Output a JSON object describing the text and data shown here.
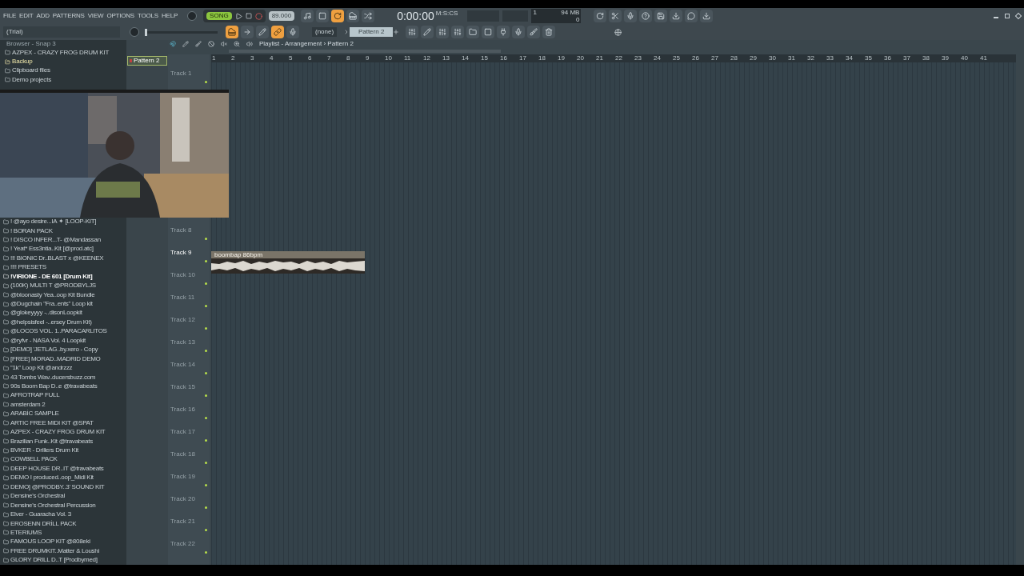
{
  "menu": [
    "FILE",
    "EDIT",
    "ADD",
    "PATTERNS",
    "VIEW",
    "OPTIONS",
    "TOOLS",
    "HELP"
  ],
  "hint": "(Trial)",
  "transport": {
    "mode": "SONG",
    "tempo": "89.000",
    "time": "0:00:00",
    "time_unit": "M:S:CS",
    "memory": "94 MB",
    "cpu": "1",
    "polyphony": "0"
  },
  "master_pitch": {
    "level": 0
  },
  "pattern_selector": "Pattern 2",
  "preset": "(none)",
  "browser": {
    "title": "Browser - Snap 3",
    "top_items": [
      {
        "label": "AZPEX - CRAZY FROG DRUM KIT",
        "selected": false
      },
      {
        "label": "Backup",
        "selected": true
      },
      {
        "label": "Clipboard files",
        "selected": false
      },
      {
        "label": "Demo projects",
        "selected": false
      }
    ],
    "items": [
      {
        "label": "! @ayo desire...IA ✦ [LOOP-KIT]",
        "selected": false
      },
      {
        "label": "! BORAN PACK",
        "selected": false
      },
      {
        "label": "! DISCO INFER...T- @Mandassan",
        "selected": false
      },
      {
        "label": "! Yeat* Ess3ntia..Kit [@prod.atc]",
        "selected": false
      },
      {
        "label": "!!! BIONIC Dr..BLAST x @KEENEX",
        "selected": false
      },
      {
        "label": "!!!! PRESETS",
        "selected": false
      },
      {
        "label": "!VIRIONE - DE 601 [Drum Kit]",
        "selected": true
      },
      {
        "label": "(100K) MULTI  T @PRODBYLJS",
        "selected": false
      },
      {
        "label": "@bloonasty Yea..oop Kit Bundle",
        "selected": false
      },
      {
        "label": "@Dugchain \"Fra..ents\" Loop kit",
        "selected": false
      },
      {
        "label": "@glokeyyyy -..disonLoopkit",
        "selected": false
      },
      {
        "label": "@helpsisfeel -..ersey Drum Kit)",
        "selected": false
      },
      {
        "label": "@LOCOS VOL. 1..PARACARLITOS",
        "selected": false
      },
      {
        "label": "@ryfvr - NASA Vol. 4 Loopkit",
        "selected": false
      },
      {
        "label": "[DEMO] 'JETLAG..by.xero - Copy",
        "selected": false
      },
      {
        "label": "[FREE] MORAD..MADRID DEMO",
        "selected": false
      },
      {
        "label": "''1k'' Loop Kit @andrzzz",
        "selected": false
      },
      {
        "label": "43 Tombs Wav..ducersbuzz.com",
        "selected": false
      },
      {
        "label": "90s Boom Bap D..e @travabeats",
        "selected": false
      },
      {
        "label": "AFROTRAP FULL",
        "selected": false
      },
      {
        "label": "amsterdam 2",
        "selected": false
      },
      {
        "label": "ARABİC SAMPLE",
        "selected": false
      },
      {
        "label": "ARTIC FREE MIDI KIT @SPAT",
        "selected": false
      },
      {
        "label": "AZPEX - CRAZY FROG DRUM KIT",
        "selected": false
      },
      {
        "label": "Brazilian Funk..Kit @travabeats",
        "selected": false
      },
      {
        "label": "BVKER - Drillers Drum Kit",
        "selected": false
      },
      {
        "label": "COWBELL PACK",
        "selected": false
      },
      {
        "label": "DEEP HOUSE DR..IT @travabeats",
        "selected": false
      },
      {
        "label": "DEMO I produced..oop_Midi Kit",
        "selected": false
      },
      {
        "label": "DEMO] @PRODBY..3' SOUND KIT",
        "selected": false
      },
      {
        "label": "Densine's Orchestral",
        "selected": false
      },
      {
        "label": "Densine's Orchestral Percussion",
        "selected": false
      },
      {
        "label": "Elver - Guaracha Vol. 3",
        "selected": false
      },
      {
        "label": "EROSENN DRİLL PACK",
        "selected": false
      },
      {
        "label": "ETERIUMS",
        "selected": false
      },
      {
        "label": "FAMOUS LOOP KIT @808eki",
        "selected": false
      },
      {
        "label": "FREE DRUMKIT..Matter & Loushi",
        "selected": false
      },
      {
        "label": "GLORY DRILL D..T [Prodbymed]",
        "selected": false
      }
    ]
  },
  "pattern_picker": {
    "items": [
      {
        "label": "Pattern 2",
        "selected": true
      }
    ]
  },
  "playlist": {
    "title": "Playlist - Arrangement › Pattern 2",
    "bars": [
      "1",
      "2",
      "3",
      "4",
      "5",
      "6",
      "7",
      "8",
      "9",
      "10",
      "11",
      "12",
      "13",
      "14",
      "15",
      "16",
      "17",
      "18",
      "19",
      "20",
      "21",
      "22",
      "23",
      "24",
      "25",
      "26",
      "27",
      "28",
      "29",
      "30",
      "31",
      "32",
      "33",
      "34",
      "35",
      "36",
      "37",
      "38",
      "39",
      "40",
      "41"
    ],
    "tracks": [
      {
        "label": "Track 1",
        "selected": false
      },
      {
        "label": "Track 8",
        "selected": false
      },
      {
        "label": "Track 9",
        "selected": true,
        "clip": {
          "label": "boombap 86bpm"
        }
      },
      {
        "label": "Track 10",
        "selected": false
      },
      {
        "label": "Track 11",
        "selected": false
      },
      {
        "label": "Track 12",
        "selected": false
      },
      {
        "label": "Track 13",
        "selected": false
      },
      {
        "label": "Track 14",
        "selected": false
      },
      {
        "label": "Track 15",
        "selected": false
      },
      {
        "label": "Track 16",
        "selected": false
      },
      {
        "label": "Track 17",
        "selected": false
      },
      {
        "label": "Track 18",
        "selected": false
      },
      {
        "label": "Track 19",
        "selected": false
      },
      {
        "label": "Track 20",
        "selected": false
      },
      {
        "label": "Track 21",
        "selected": false
      },
      {
        "label": "Track 22",
        "selected": false
      }
    ]
  }
}
